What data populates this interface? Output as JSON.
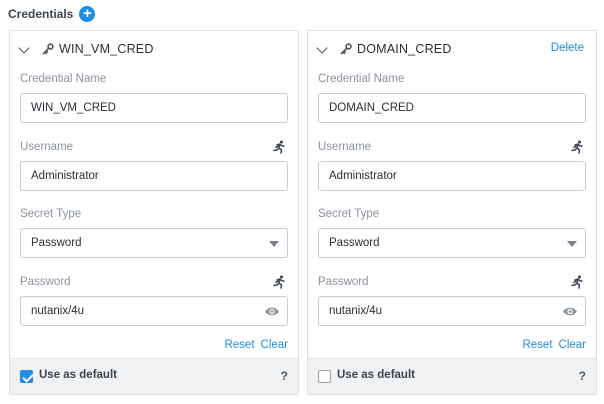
{
  "colors": {
    "accent": "#1f8ce6"
  },
  "section": {
    "title": "Credentials",
    "add_icon": "+"
  },
  "credentials": [
    {
      "name": "WIN_VM_CRED",
      "delete_label": "",
      "fields": {
        "credential_name": {
          "label": "Credential Name",
          "value": "WIN_VM_CRED"
        },
        "username": {
          "label": "Username",
          "value": "Administrator"
        },
        "secret_type": {
          "label": "Secret Type",
          "value": "Password"
        },
        "password": {
          "label": "Password",
          "value": "nutanix/4u"
        }
      },
      "reset_label": "Reset",
      "clear_label": "Clear",
      "use_default_label": "Use as default",
      "use_default_checked": true,
      "help_label": "?"
    },
    {
      "name": "DOMAIN_CRED",
      "delete_label": "Delete",
      "fields": {
        "credential_name": {
          "label": "Credential Name",
          "value": "DOMAIN_CRED"
        },
        "username": {
          "label": "Username",
          "value": "Administrator"
        },
        "secret_type": {
          "label": "Secret Type",
          "value": "Password"
        },
        "password": {
          "label": "Password",
          "value": "nutanix/4u"
        }
      },
      "reset_label": "Reset",
      "clear_label": "Clear",
      "use_default_label": "Use as default",
      "use_default_checked": false,
      "help_label": "?"
    }
  ],
  "icons": {
    "collapse": "chevron-down-icon",
    "key": "key-icon",
    "macro": "running-person-icon",
    "reveal": "eye-icon",
    "dropdown": "caret-down-icon"
  }
}
